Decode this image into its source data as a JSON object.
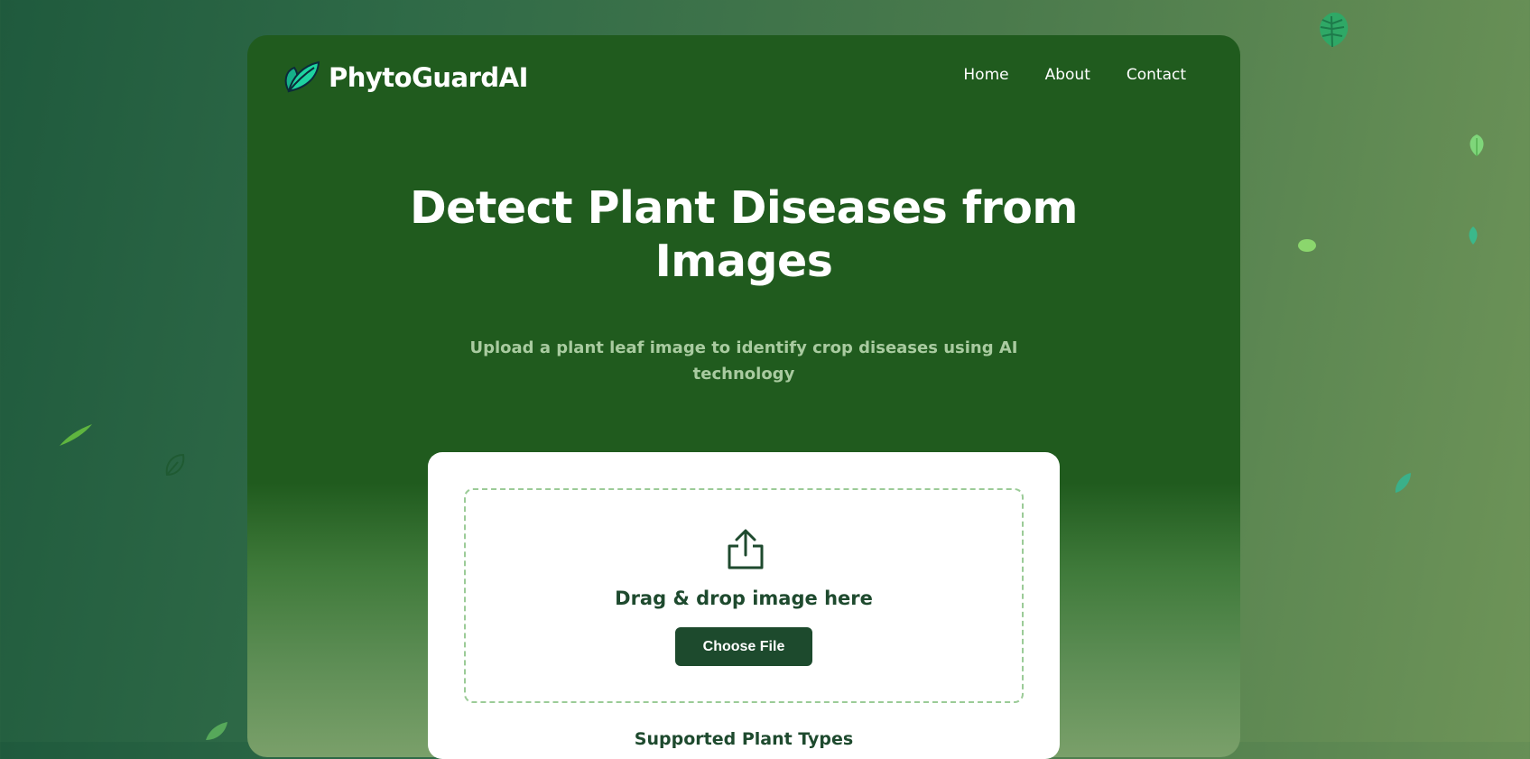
{
  "brand": {
    "name": "PhytoGuardAI",
    "logo_icon": "leaf-icon"
  },
  "nav": {
    "links": [
      "Home",
      "About",
      "Contact"
    ]
  },
  "hero": {
    "title_line1": "Detect Plant Diseases from",
    "title_line2": "Images",
    "subtitle_line1": "Upload a plant leaf image to identify crop diseases using AI",
    "subtitle_line2": "technology"
  },
  "upload": {
    "icon": "upload-icon",
    "drop_text": "Drag & drop image here",
    "button_label": "Choose File",
    "supported_heading": "Supported Plant Types"
  },
  "colors": {
    "card_green": "#205b1e",
    "button": "#1d4a2d",
    "dropzone_border": "#9bcb97"
  }
}
